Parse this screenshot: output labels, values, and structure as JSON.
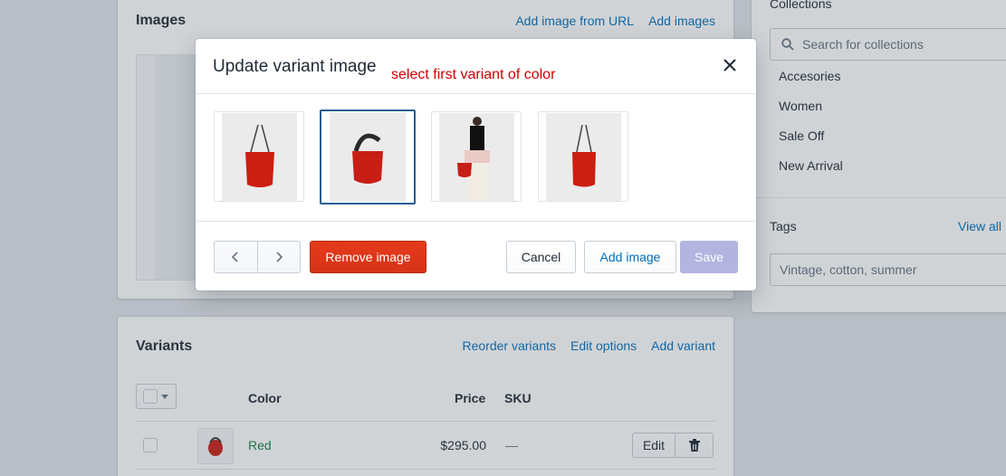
{
  "images_card": {
    "title": "Images",
    "add_from_url": "Add image from URL",
    "add_images": "Add images"
  },
  "variants_card": {
    "title": "Variants",
    "reorder": "Reorder variants",
    "edit_options": "Edit options",
    "add_variant": "Add variant",
    "columns": {
      "color": "Color",
      "price": "Price",
      "sku": "SKU"
    },
    "rows": [
      {
        "color": "Red",
        "price": "$295.00",
        "sku": "—",
        "edit": "Edit"
      }
    ]
  },
  "collections_card": {
    "label": "Collections",
    "search_placeholder": "Search for collections",
    "items": [
      "Accesories",
      "Women",
      "Sale Off",
      "New Arrival"
    ],
    "tags_label": "Tags",
    "view_all": "View all",
    "tags_placeholder": "Vintage, cotton, summer"
  },
  "modal": {
    "title": "Update variant image",
    "annotation": "select first variant of color",
    "images": [
      {
        "name": "red-bucket-bag-front",
        "selected": false
      },
      {
        "name": "red-bucket-bag-angle",
        "selected": true
      },
      {
        "name": "model-with-red-bag",
        "selected": false
      },
      {
        "name": "red-bucket-bag-side",
        "selected": false
      }
    ],
    "remove_image": "Remove image",
    "cancel": "Cancel",
    "add_image": "Add image",
    "save": "Save"
  },
  "colors": {
    "accent": "#006fbb",
    "danger": "#de3618",
    "success_text": "#108043",
    "save_disabled": "#b3b5e0",
    "annotation": "#d00000",
    "selected_border": "#2a5d94"
  }
}
